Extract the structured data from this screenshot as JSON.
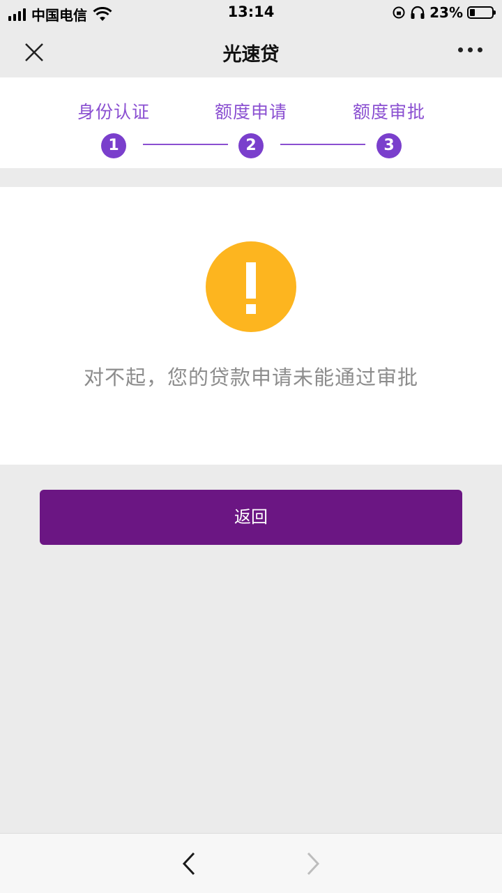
{
  "status_bar": {
    "carrier": "中国电信",
    "time": "13:14",
    "battery_percent": "23%",
    "battery_level": 0.23
  },
  "navbar": {
    "title": "光速贷",
    "close_icon": "close-icon",
    "more_icon": "more-dots-icon"
  },
  "steps": [
    {
      "label": "身份认证",
      "number": "1"
    },
    {
      "label": "额度申请",
      "number": "2"
    },
    {
      "label": "额度审批",
      "number": "3"
    }
  ],
  "result": {
    "icon": "warning-icon",
    "icon_color": "#fdb51f",
    "message": "对不起，您的贷款申请未能通过审批"
  },
  "actions": {
    "back_label": "返回",
    "button_color": "#6b1683"
  },
  "browser_nav": {
    "back_icon": "chevron-left-icon",
    "forward_icon": "chevron-right-icon"
  }
}
